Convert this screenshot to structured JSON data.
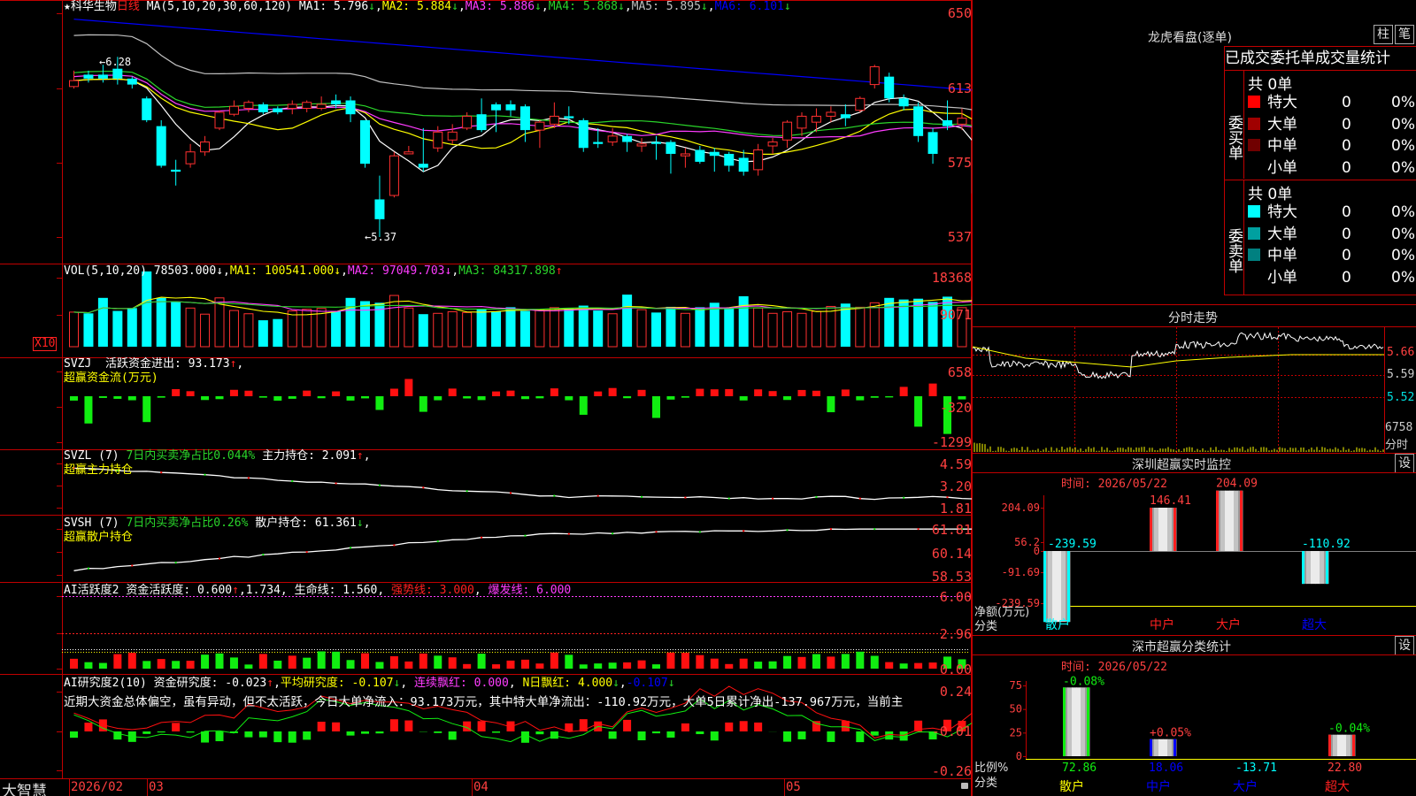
{
  "main": {
    "star": "★",
    "stock_name": "科华生物",
    "period": "日线",
    "ma_label": "MA(5,10,20,30,60,120)",
    "ma": [
      {
        "label": "MA1: 5.796",
        "arrow": "↓",
        "color": "#ffffff"
      },
      {
        "label": "MA2: 5.884",
        "arrow": "↓",
        "color": "#ffff00"
      },
      {
        "label": "MA3: 5.886",
        "arrow": "↓",
        "color": "#ff3cff"
      },
      {
        "label": "MA4: 5.868",
        "arrow": "↓",
        "color": "#2ad42a"
      },
      {
        "label": "MA5: 5.895",
        "arrow": "↓",
        "color": "#c0c0c0"
      },
      {
        "label": "MA6: 6.101",
        "arrow": "↓",
        "color": "#0000ff"
      }
    ],
    "y_ticks": [
      "650",
      "613",
      "575",
      "537"
    ],
    "high_marker": "6.28",
    "low_marker": "5.37"
  },
  "vol": {
    "label": "VOL(5,10,20)",
    "value": "78503.000",
    "ma1": "MA1: 100541.000",
    "ma2": "MA2: 97049.703",
    "ma3": "MA3: 84317.898",
    "y_ticks": [
      "18368",
      "9071"
    ],
    "unit_badge": "X10"
  },
  "svzj": {
    "label": "SVZJ",
    "active_text": "活跃资金进出: 93.173",
    "subtitle": "超赢资金流(万元)",
    "y_ticks": [
      "658",
      "-320",
      "-1299"
    ]
  },
  "svzl": {
    "label": "SVZL (7)",
    "ratio_text": "7日内买卖净占比0.044%",
    "main_text": "主力持仓: 2.091",
    "subtitle": "超赢主力持仓",
    "y_ticks": [
      "4.59",
      "3.20",
      "1.81"
    ]
  },
  "svsh": {
    "label": "SVSH (7)",
    "ratio_text": "7日内买卖净占比0.26%",
    "retail_text": "散户持仓: 61.361",
    "subtitle": "超赢散户持仓",
    "y_ticks": [
      "61.81",
      "60.14",
      "58.53"
    ]
  },
  "ai1": {
    "label": "AI活跃度2",
    "active": "资金活跃度: 0.600",
    "v2": "1.734",
    "life": "生命线: 1.560",
    "strong": "强势线: 3.000",
    "burst": "爆发线: 6.000",
    "y_ticks": [
      "6.00",
      "2.96",
      "0.00"
    ]
  },
  "ai2": {
    "label": "AI研究度2(10)",
    "research": "资金研究度: -0.023",
    "avg": "平均研究度: -0.107",
    "red": "连续飘红: 0.000",
    "nred": "N日飘红: 4.000",
    "last": "-0.107",
    "comment": "近期大资金总体偏空，虽有异动，但不太活跃，今日大单净流入：93.173万元，其中特大单净流出：-110.92万元，大单5日累计净出-137.967万元，当前主",
    "y_ticks": [
      "0.24",
      "-0.01",
      "-0.26"
    ]
  },
  "footer": {
    "brand": "大智慧",
    "dates": [
      "2026/02",
      "03",
      "04",
      "05"
    ]
  },
  "right": {
    "title": "龙虎看盘(逐单)",
    "btn_bar": "柱",
    "btn_pen": "笔",
    "order_header": "已成交委托单成交量统计",
    "buy_group": "委买单",
    "sell_group": "委卖单",
    "buy_total": "共 0单",
    "sell_total": "共 0单",
    "buy_rows": [
      {
        "label": "特大",
        "count": "0",
        "pct": "0%",
        "color": "#ff0000"
      },
      {
        "label": "大单",
        "count": "0",
        "pct": "0%",
        "color": "#a00000"
      },
      {
        "label": "中单",
        "count": "0",
        "pct": "0%",
        "color": "#700000"
      },
      {
        "label": "小单",
        "count": "0",
        "pct": "0%",
        "color": ""
      }
    ],
    "sell_rows": [
      {
        "label": "特大",
        "count": "0",
        "pct": "0%",
        "color": "#00ffff"
      },
      {
        "label": "大单",
        "count": "0",
        "pct": "0%",
        "color": "#00a0a0"
      },
      {
        "label": "中单",
        "count": "0",
        "pct": "0%",
        "color": "#008080"
      },
      {
        "label": "小单",
        "count": "0",
        "pct": "0%",
        "color": ""
      }
    ],
    "intraday_title": "分时走势",
    "intraday_ticks": [
      "5.66",
      "5.59",
      "5.52",
      "6758",
      "分时"
    ],
    "sz_title": "深圳超赢实时监控",
    "sz_set": "设",
    "sz_time": "时间: 2026/05/22",
    "sz_yticks": [
      "204.09",
      "56.2",
      "0",
      "-91.69",
      "-239.59"
    ],
    "sz_ylabel": "净额(万元)",
    "sz_xlabel": "分类",
    "sz_cats": [
      "散户",
      "中户",
      "大户",
      "超大"
    ],
    "sz_values": [
      "-239.59",
      "146.41",
      "204.09",
      "-110.92"
    ],
    "cls_title": "深市超赢分类统计",
    "cls_set": "设",
    "cls_time": "时间: 2026/05/22",
    "cls_yticks": [
      "75",
      "50",
      "25",
      "0"
    ],
    "cls_ylabel": "比例%",
    "cls_xlabel": "分类",
    "cls_cats": [
      "散户",
      "中户",
      "大户",
      "超大"
    ],
    "cls_top": [
      "-0.08%",
      "+0.05%",
      "",
      "-0.04%"
    ],
    "cls_bottom": [
      "72.86",
      "18.06",
      "-13.71",
      "22.80"
    ]
  },
  "chart_data": [
    {
      "type": "candlestick",
      "title": "科华生物 日线",
      "ylim": [
        5.37,
        6.5
      ],
      "candles": [
        [
          6.13,
          6.16,
          6.12,
          6.21
        ],
        [
          6.19,
          6.17,
          6.15,
          6.21
        ],
        [
          6.19,
          6.17,
          6.15,
          6.24
        ],
        [
          6.22,
          6.17,
          6.14,
          6.28
        ],
        [
          6.17,
          6.14,
          6.12,
          6.18
        ],
        [
          6.07,
          5.96,
          5.95,
          6.08
        ],
        [
          5.93,
          5.73,
          5.72,
          5.96
        ],
        [
          5.71,
          5.7,
          5.63,
          5.76
        ],
        [
          5.74,
          5.8,
          5.72,
          5.84
        ],
        [
          5.8,
          5.85,
          5.78,
          5.88
        ],
        [
          5.92,
          6.0,
          5.91,
          6.01
        ],
        [
          5.99,
          6.03,
          5.98,
          6.06
        ],
        [
          6.02,
          6.05,
          6.0,
          6.06
        ],
        [
          6.04,
          6.0,
          5.99,
          6.05
        ],
        [
          6.02,
          6.0,
          5.99,
          6.03
        ],
        [
          6.02,
          6.04,
          5.99,
          6.06
        ],
        [
          6.02,
          6.05,
          6.0,
          6.06
        ],
        [
          6.02,
          6.04,
          6.01,
          6.08
        ],
        [
          6.06,
          6.04,
          6.02,
          6.09
        ],
        [
          6.06,
          5.99,
          5.95,
          6.08
        ],
        [
          5.96,
          5.74,
          5.72,
          5.96
        ],
        [
          5.56,
          5.46,
          5.37,
          5.68
        ],
        [
          5.58,
          5.78,
          5.57,
          5.8
        ],
        [
          5.79,
          5.8,
          5.79,
          5.83
        ],
        [
          5.74,
          5.72,
          5.7,
          5.92
        ],
        [
          5.82,
          5.9,
          5.8,
          5.93
        ],
        [
          5.86,
          5.9,
          5.84,
          5.94
        ],
        [
          5.92,
          5.98,
          5.91,
          6.0
        ],
        [
          5.99,
          5.91,
          5.9,
          6.07
        ],
        [
          6.04,
          6.01,
          5.9,
          6.05
        ],
        [
          6.04,
          6.01,
          5.98,
          6.06
        ],
        [
          6.03,
          5.91,
          5.85,
          6.04
        ],
        [
          5.91,
          5.95,
          5.82,
          5.96
        ],
        [
          5.94,
          5.98,
          5.92,
          6.05
        ],
        [
          5.98,
          5.97,
          5.94,
          6.03
        ],
        [
          5.96,
          5.82,
          5.8,
          5.97
        ],
        [
          5.85,
          5.84,
          5.82,
          5.92
        ],
        [
          5.85,
          5.88,
          5.83,
          5.92
        ],
        [
          5.88,
          5.85,
          5.8,
          5.89
        ],
        [
          5.83,
          5.84,
          5.8,
          5.87
        ],
        [
          5.85,
          5.84,
          5.76,
          5.88
        ],
        [
          5.85,
          5.79,
          5.69,
          5.86
        ],
        [
          5.78,
          5.79,
          5.72,
          5.82
        ],
        [
          5.81,
          5.75,
          5.74,
          5.83
        ],
        [
          5.8,
          5.78,
          5.7,
          5.82
        ],
        [
          5.79,
          5.73,
          5.7,
          5.8
        ],
        [
          5.77,
          5.7,
          5.68,
          5.81
        ],
        [
          5.71,
          5.81,
          5.68,
          5.84
        ],
        [
          5.83,
          5.85,
          5.79,
          5.87
        ],
        [
          5.86,
          5.95,
          5.82,
          5.96
        ],
        [
          5.92,
          5.98,
          5.88,
          6.0
        ],
        [
          5.95,
          5.98,
          5.9,
          6.02
        ],
        [
          5.98,
          6.0,
          5.95,
          6.03
        ],
        [
          5.99,
          5.97,
          5.93,
          6.04
        ],
        [
          6.01,
          6.07,
          6.0,
          6.08
        ],
        [
          6.14,
          6.23,
          6.12,
          6.24
        ],
        [
          6.18,
          6.07,
          6.05,
          6.2
        ],
        [
          6.07,
          6.03,
          6.01,
          6.09
        ],
        [
          6.03,
          5.88,
          5.85,
          6.05
        ],
        [
          5.9,
          5.79,
          5.74,
          5.92
        ],
        [
          5.96,
          5.93,
          5.91,
          6.06
        ],
        [
          5.94,
          5.97,
          5.91,
          6.02
        ],
        [
          5.96,
          5.59,
          5.55,
          5.99
        ],
        [
          5.63,
          5.67,
          5.55,
          5.74
        ]
      ]
    },
    {
      "type": "bar",
      "title": "VOL(5,10,20)",
      "ylim": [
        0,
        20000
      ],
      "values": [
        8500,
        8200,
        12000,
        8800,
        9500,
        18500,
        12000,
        11000,
        9500,
        8000,
        12000,
        8900,
        8100,
        6500,
        6800,
        8800,
        9200,
        9400,
        8800,
        12000,
        11200,
        10800,
        12600,
        9500,
        8000,
        8200,
        8600,
        8400,
        9300,
        8700,
        9700,
        8800,
        8900,
        9600,
        9400,
        10100,
        8900,
        8100,
        12800,
        9100,
        8400,
        9800,
        8200,
        9700,
        10800,
        9500,
        12400,
        9500,
        8200,
        8600,
        8200,
        8700,
        9900,
        10600,
        9700,
        10800,
        12000,
        11600,
        11800,
        11000,
        12300,
        9600,
        12300,
        9800
      ]
    }
  ]
}
